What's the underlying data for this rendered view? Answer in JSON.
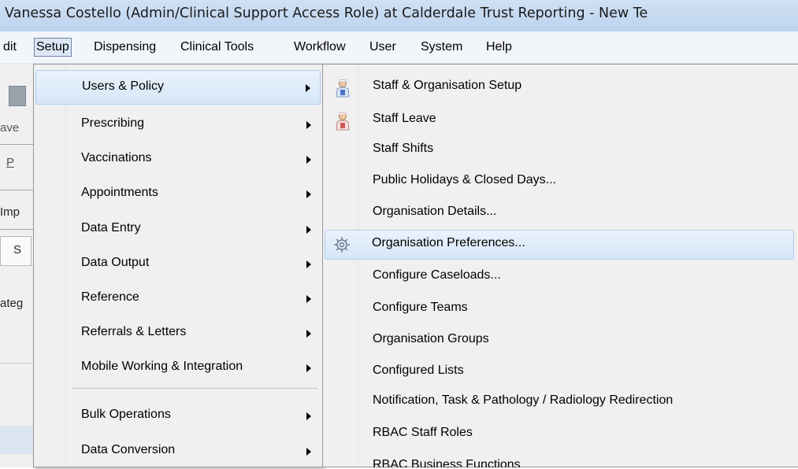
{
  "window": {
    "title": "Vanessa Costello (Admin/Clinical Support Access Role) at Calderdale Trust Reporting - New Te"
  },
  "menubar": {
    "items": [
      "dit",
      "Setup",
      "Dispensing",
      "Clinical Tools",
      "Workflow",
      "User",
      "System",
      "Help"
    ],
    "active": "Setup"
  },
  "background": {
    "fragments": [
      "ave",
      "P",
      "Imp",
      "S",
      "ateg"
    ]
  },
  "setup_menu": {
    "items": [
      {
        "label": "Users & Policy",
        "has_submenu": true,
        "selected": true
      },
      {
        "label": "Prescribing",
        "has_submenu": true
      },
      {
        "label": "Vaccinations",
        "has_submenu": true
      },
      {
        "label": "Appointments",
        "has_submenu": true
      },
      {
        "label": "Data Entry",
        "has_submenu": true
      },
      {
        "label": "Data Output",
        "has_submenu": true
      },
      {
        "label": "Reference",
        "has_submenu": true
      },
      {
        "label": "Referrals & Letters",
        "has_submenu": true
      },
      {
        "label": "Mobile Working & Integration",
        "has_submenu": true
      },
      {
        "label": "Bulk Operations",
        "has_submenu": true
      },
      {
        "label": "Data Conversion",
        "has_submenu": true
      }
    ]
  },
  "users_policy_submenu": {
    "items": [
      {
        "label": "Staff & Organisation Setup",
        "icon": "staff-setup-icon"
      },
      {
        "label": "Staff Leave",
        "icon": "staff-leave-icon"
      },
      {
        "label": "Staff Shifts"
      },
      {
        "label": "Public Holidays & Closed Days..."
      },
      {
        "label": "Organisation Details..."
      },
      {
        "label": "Organisation Preferences...",
        "icon": "gear-icon",
        "selected": true
      },
      {
        "label": "Configure Caseloads..."
      },
      {
        "label": "Configure Teams"
      },
      {
        "label": "Organisation Groups"
      },
      {
        "label": "Configured Lists"
      },
      {
        "label": "Notification, Task & Pathology / Radiology Redirection"
      },
      {
        "label": "RBAC Staff Roles"
      },
      {
        "label": "RBAC Business Functions"
      }
    ]
  },
  "colors": {
    "titlebar": "#c4d8f0",
    "menu_background": "#f0f0f0",
    "selection_border": "#aecbef",
    "selection_fill": "#dde9f8"
  }
}
